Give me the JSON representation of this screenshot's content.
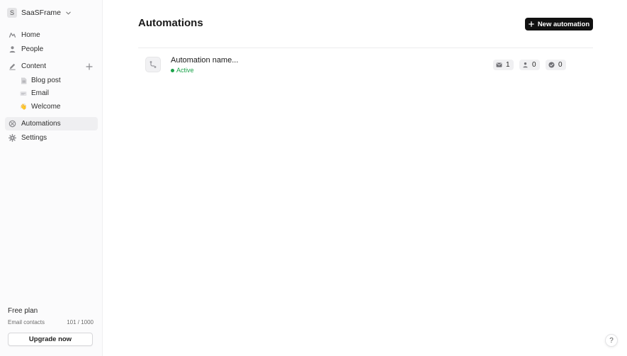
{
  "workspace": {
    "initial": "S",
    "name": "SaaSFrame"
  },
  "nav": {
    "home": "Home",
    "people": "People",
    "content": "Content",
    "content_items": [
      {
        "label": "Blog post",
        "icon": "document-icon"
      },
      {
        "label": "Email",
        "icon": "email-template-icon"
      },
      {
        "label": "Welcome",
        "icon": "waving-hand-emoji"
      }
    ],
    "automations": "Automations",
    "settings": "Settings"
  },
  "plan": {
    "title": "Free plan",
    "contacts_label": "Email contacts",
    "contacts_value": "101 / 1000",
    "upgrade_label": "Upgrade now"
  },
  "main": {
    "title": "Automations",
    "new_button_label": "New automation",
    "automations": [
      {
        "name": "Automation name...",
        "status": "Active",
        "emails": "1",
        "contacts": "0",
        "completed": "0"
      }
    ]
  },
  "help_label": "?",
  "colors": {
    "active_status": "#1aa34a",
    "primary_button": "#111111"
  }
}
